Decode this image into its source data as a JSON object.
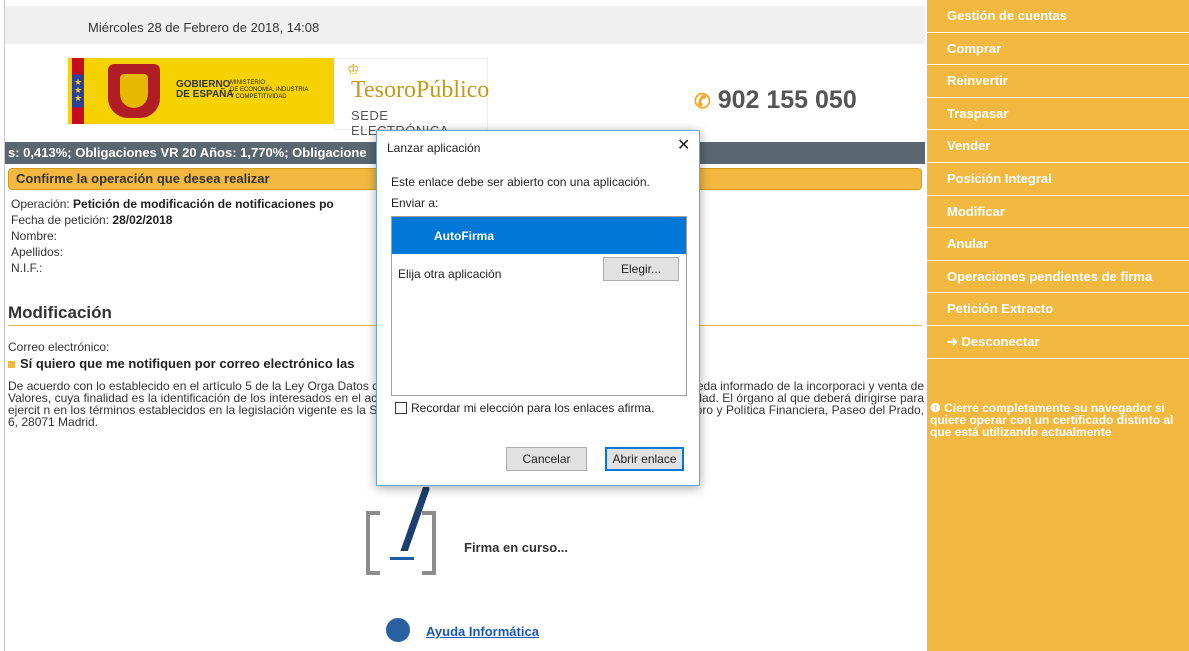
{
  "header": {
    "date": "Miércoles 28 de Febrero de 2018, 14:08",
    "gobierno_label": "GOBIERNO\nDE ESPAÑA",
    "ministerio_label": "MINISTERIO\nDE ECONOMÍA, INDUSTRIA\nY COMPETITIVIDAD",
    "tesoro_logo": "TesoroPúblico",
    "sede_label": "SEDE ELECTRÓNICA",
    "phone": "902 155 050",
    "phone_icon": "phone-icon"
  },
  "ticker": "s: 0,413%; Obligaciones VR 20 Años: 1,770%; Obligacione",
  "confirm_banner": "Confirme la operación que desea realizar",
  "fields": {
    "operacion_label": "Operación:",
    "operacion_value": "Petición de modificación de notificaciones po",
    "fecha_label": "Fecha de petición:",
    "fecha_value": "28/02/2018",
    "nombre_label": "Nombre:",
    "apellidos_label": "Apellidos:",
    "nif_label": "N.I.F.:"
  },
  "section": {
    "title": "Modificación",
    "email_label": "Correo electrónico:",
    "email_option": "Sí quiero que me notifiquen por correo electrónico las",
    "legal_text": "De acuerdo con lo establecido en el artículo 5 de la Ley Orga                                                                                                               Datos de Carácter Personal, el titular de los datos suministrados queda informado de la incorporaci                                                                                                                  y venta de Valores, cuya finalidad es la identificación de los interesados en el acceso al servic                                                                                                                 rnet del Ministerio de Economía y Competitividad. El órgano al que deberá dirigirse para ejercit                                                                                                             n en los términos establecidos en la legislación vigente es la Subdirección General de Financiació                                                                                                             rección General del Tesoro y Política Financiera, Paseo del Prado, 6, 28071 Madrid."
  },
  "firma": {
    "status_text": "Firma en curso...",
    "icon": "signature-pen-icon"
  },
  "ayuda": {
    "link_text": "Ayuda Informática",
    "icon": "gear-help-icon"
  },
  "sidebar": {
    "items": [
      {
        "label": "Gestión de cuentas"
      },
      {
        "label": "Comprar"
      },
      {
        "label": "Reinvertir"
      },
      {
        "label": "Traspasar"
      },
      {
        "label": "Vender"
      },
      {
        "label": "Posición Integral"
      },
      {
        "label": "Modificar"
      },
      {
        "label": "Anular"
      },
      {
        "label": "Operaciones pendientes de firma"
      },
      {
        "label": "Petición Extracto"
      },
      {
        "label": "Desconectar",
        "icon": "logout-icon"
      }
    ],
    "note": "Cierre completamente su navegador si quiere operar con un certificado distinto al que está utilizando actualmente",
    "note_icon": "info-icon"
  },
  "dialog": {
    "title": "Lanzar aplicación",
    "message": "Este enlace debe ser abierto con una aplicación.",
    "send_to": "Enviar a:",
    "selected_app": "AutoFirma",
    "other_app": "Elija otra aplicación",
    "choose_button": "Elegir...",
    "remember": "Recordar mi elección para los enlaces afirma.",
    "remember_checked": false,
    "cancel_button": "Cancelar",
    "open_button": "Abrir enlace"
  },
  "colors": {
    "accent": "#f2b840",
    "ticker_bg": "#5b6770",
    "dialog_select": "#0078d7",
    "link": "#1a56b8"
  }
}
